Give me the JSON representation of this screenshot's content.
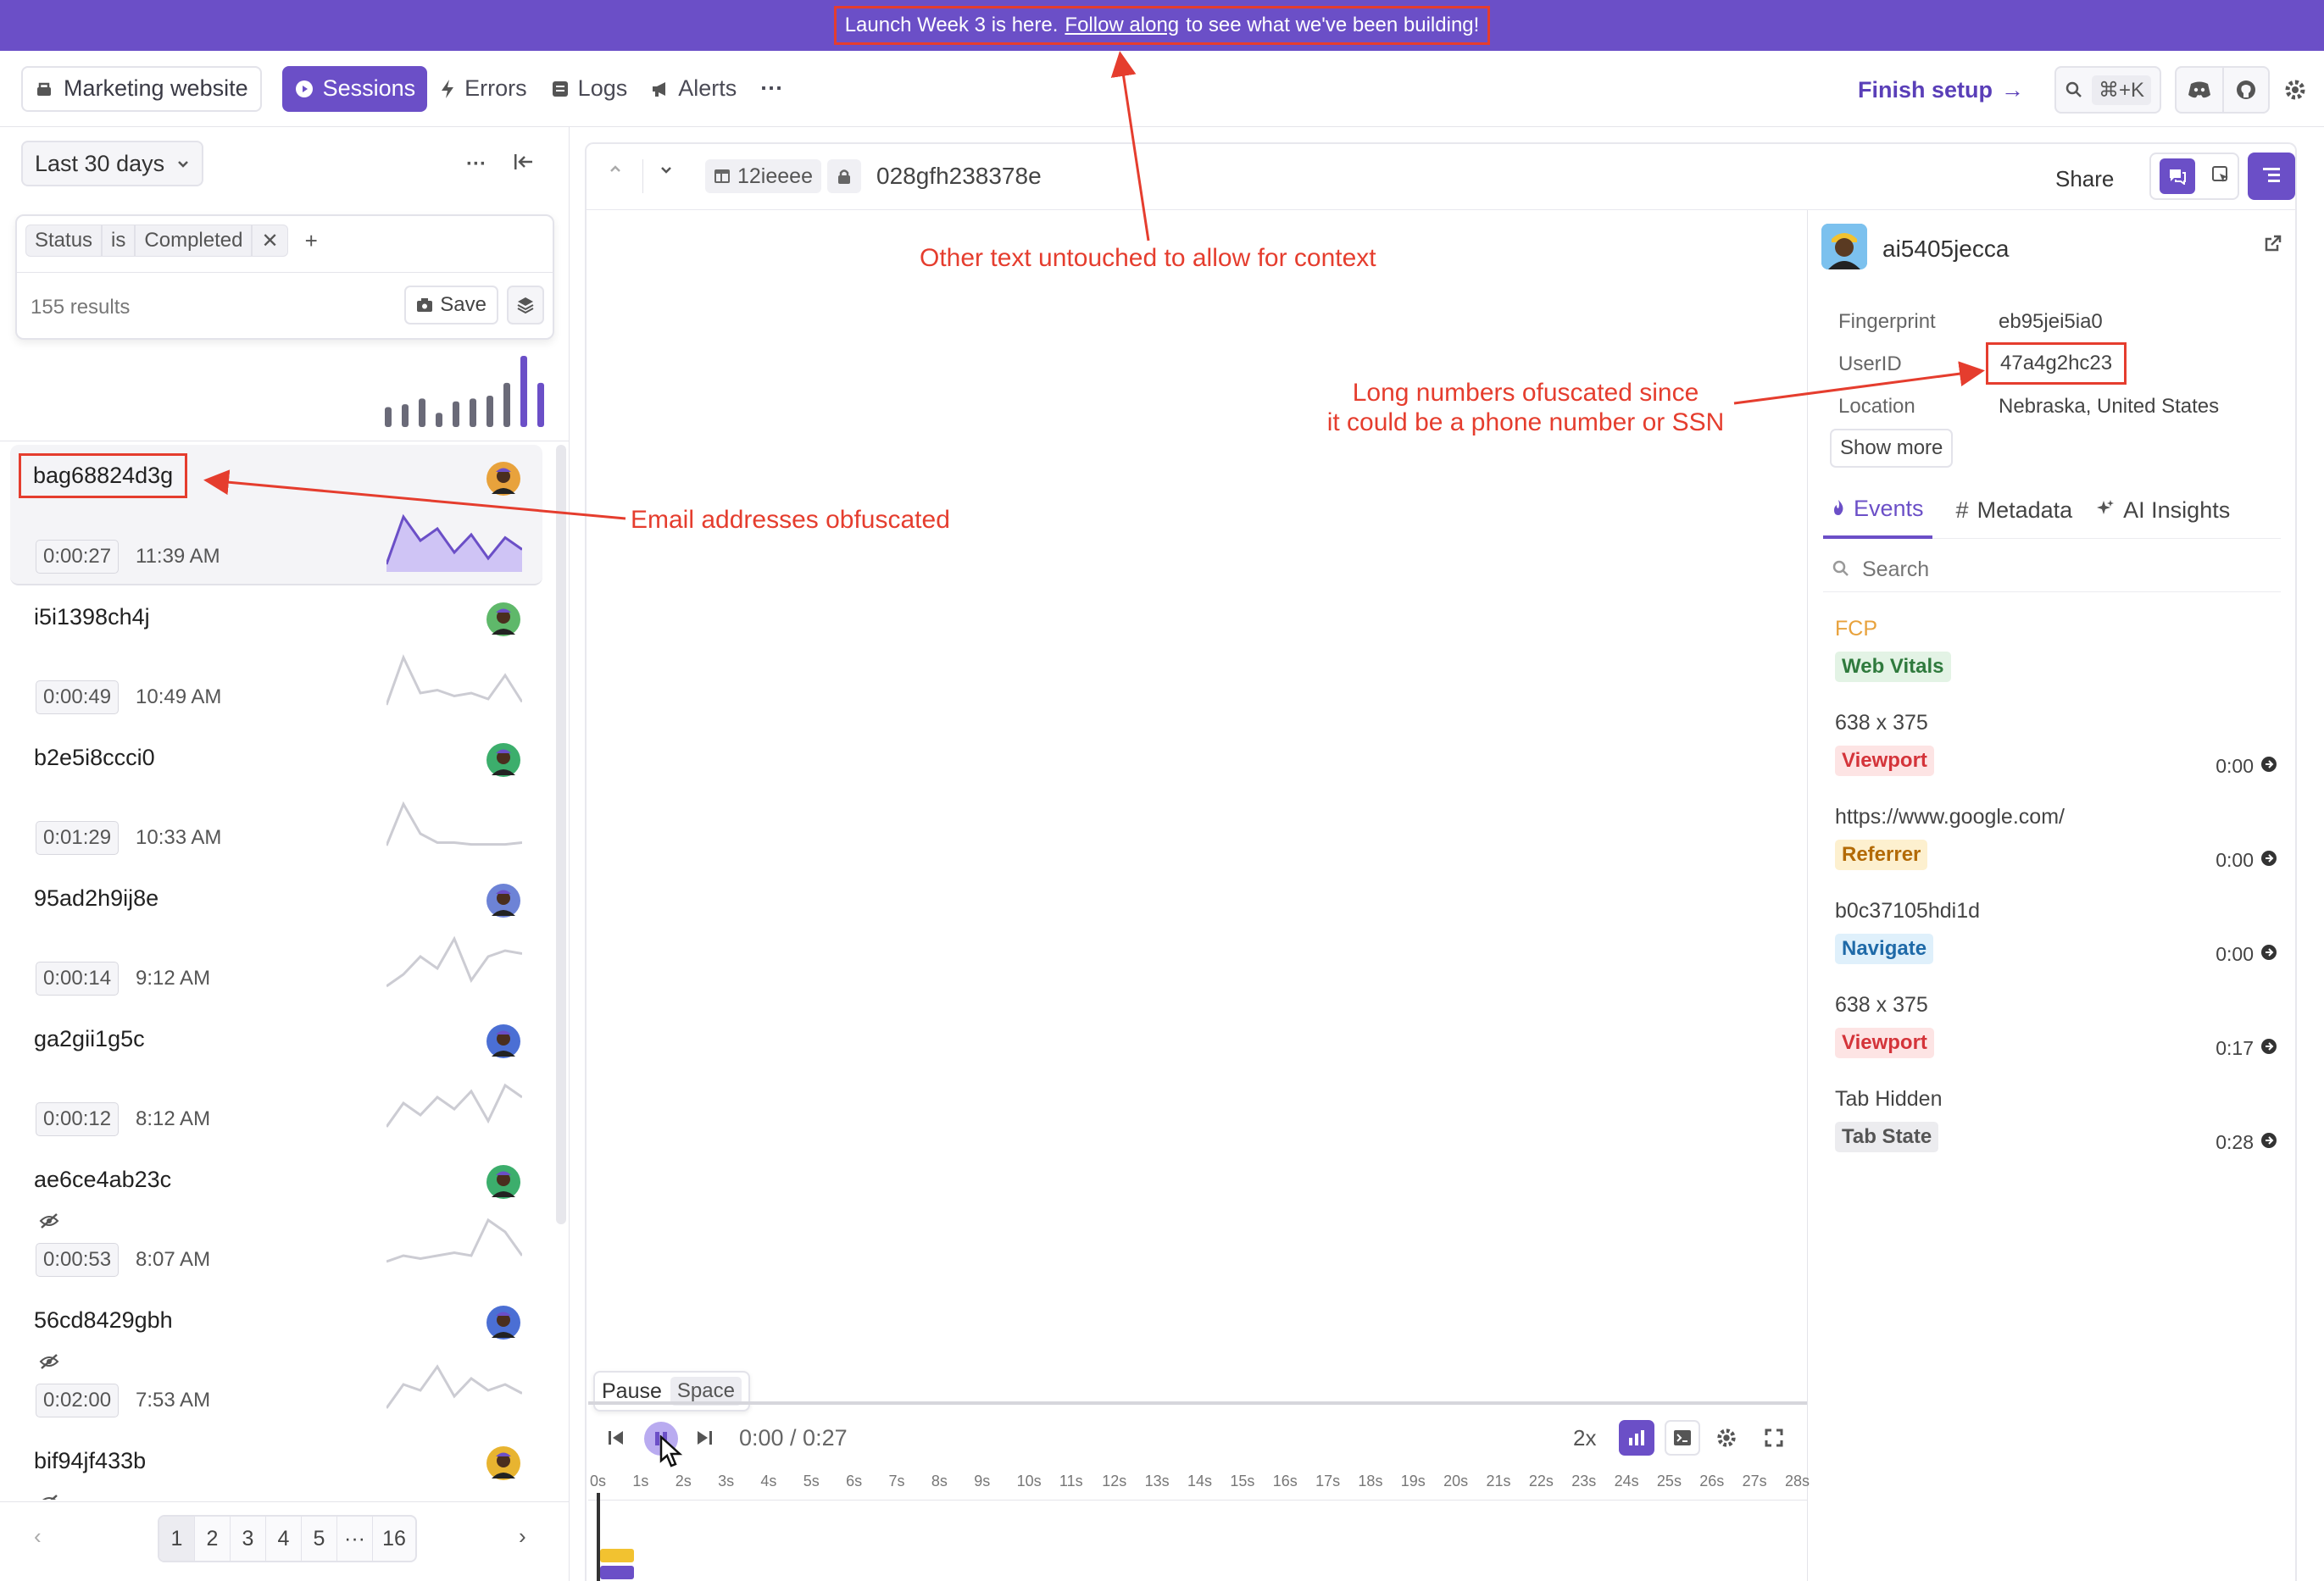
{
  "banner": {
    "pre": "Launch Week 3 is here.",
    "link": "Follow along",
    "post": "to see what we've been building!"
  },
  "nav": {
    "project": "Marketing website",
    "items": [
      {
        "label": "Sessions"
      },
      {
        "label": "Errors"
      },
      {
        "label": "Logs"
      },
      {
        "label": "Alerts"
      }
    ],
    "more": "···",
    "finish_setup": "Finish setup",
    "search_shortcut": "⌘+K"
  },
  "sidebar": {
    "date_range": "Last 30 days",
    "filter": {
      "field": "Status",
      "op": "is",
      "value": "Completed",
      "add": "+"
    },
    "results": "155 results",
    "save": "Save",
    "histogram": [
      0.28,
      0.32,
      0.4,
      0.2,
      0.36,
      0.4,
      0.44,
      0.62,
      1.0,
      0.62
    ],
    "sessions": [
      {
        "id": "bag68824d3g",
        "duration": "0:00:27",
        "time": "11:39 AM",
        "hidden": false
      },
      {
        "id": "i5i1398ch4j",
        "duration": "0:00:49",
        "time": "10:49 AM",
        "hidden": false
      },
      {
        "id": "b2e5i8ccci0",
        "duration": "0:01:29",
        "time": "10:33 AM",
        "hidden": false
      },
      {
        "id": "95ad2h9ij8e",
        "duration": "0:00:14",
        "time": "9:12 AM",
        "hidden": false
      },
      {
        "id": "ga2gii1g5c",
        "duration": "0:00:12",
        "time": "8:12 AM",
        "hidden": false
      },
      {
        "id": "ae6ce4ab23c",
        "duration": "0:00:53",
        "time": "8:07 AM",
        "hidden": true
      },
      {
        "id": "56cd8429gbh",
        "duration": "0:02:00",
        "time": "7:53 AM",
        "hidden": true
      },
      {
        "id": "bif94jf433b",
        "duration": "",
        "time": "",
        "hidden": true
      }
    ],
    "pages": [
      "1",
      "2",
      "3",
      "4",
      "5",
      "···",
      "16"
    ]
  },
  "session_header": {
    "tag": "12ieeee",
    "secure_id": "028gfh238378e",
    "share": "Share"
  },
  "user_panel": {
    "user": "ai5405jecca",
    "details": [
      {
        "key": "Fingerprint",
        "value": "eb95jei5ia0"
      },
      {
        "key": "UserID",
        "value": "47a4g2hc23"
      },
      {
        "key": "Location",
        "value": "Nebraska, United States"
      }
    ],
    "show_more": "Show more",
    "tabs": [
      {
        "label": "Events"
      },
      {
        "label": "Metadata"
      },
      {
        "label": "AI Insights"
      }
    ],
    "search_placeholder": "Search",
    "events": [
      {
        "title": "FCP",
        "badge": "Web Vitals",
        "time": "",
        "badge_bg": "#e3f3e5",
        "badge_fg": "#2f7a3d"
      },
      {
        "title": "638 x 375",
        "badge": "Viewport",
        "time": "0:00",
        "badge_bg": "#fde4e4",
        "badge_fg": "#d4343a"
      },
      {
        "title": "https://www.google.com/",
        "badge": "Referrer",
        "time": "0:00",
        "badge_bg": "#fdf0cf",
        "badge_fg": "#b36a06"
      },
      {
        "title": "b0c37105hdi1d",
        "badge": "Navigate",
        "time": "0:00",
        "badge_bg": "#dff0fb",
        "badge_fg": "#1f6aa8"
      },
      {
        "title": "638 x 375",
        "badge": "Viewport",
        "time": "0:17",
        "badge_bg": "#fde4e4",
        "badge_fg": "#d4343a"
      },
      {
        "title": "Tab Hidden",
        "badge": "Tab State",
        "time": "0:28",
        "badge_bg": "#ececef",
        "badge_fg": "#555"
      }
    ]
  },
  "player": {
    "tooltip_label": "Pause",
    "tooltip_key": "Space",
    "time": "0:00 / 0:27",
    "speed": "2x",
    "ticks": [
      "0s",
      "1s",
      "2s",
      "3s",
      "4s",
      "5s",
      "6s",
      "7s",
      "8s",
      "9s",
      "10s",
      "11s",
      "12s",
      "13s",
      "14s",
      "15s",
      "16s",
      "17s",
      "18s",
      "19s",
      "20s",
      "21s",
      "22s",
      "23s",
      "24s",
      "25s",
      "26s",
      "27s",
      "28s"
    ]
  },
  "annotations": {
    "context": "Other text untouched to allow for context",
    "numbers_l1": "Long numbers ofuscated since",
    "numbers_l2": "it could be a phone number or SSN",
    "emails": "Email addresses obfuscated"
  },
  "colors": {
    "accent": "#6b4fc7",
    "annotation": "#e53d2e"
  }
}
